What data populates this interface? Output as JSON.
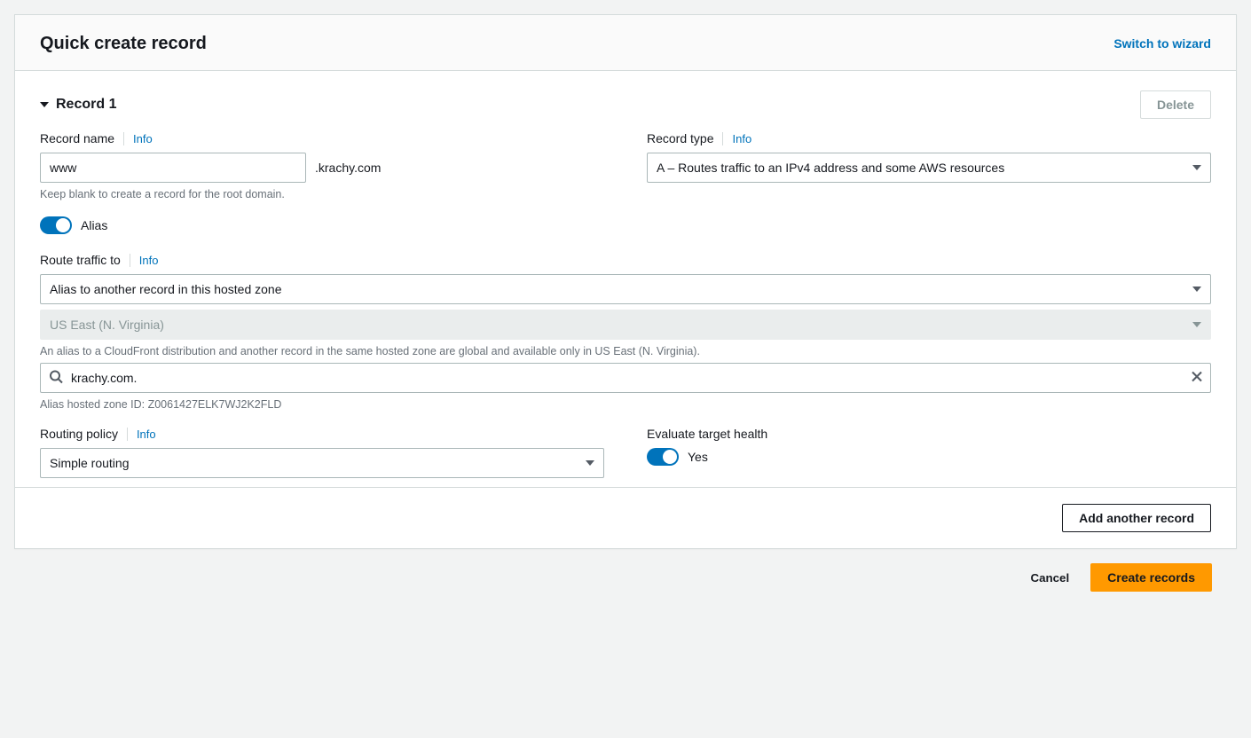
{
  "header": {
    "title": "Quick create record",
    "switch_link": "Switch to wizard"
  },
  "record": {
    "title": "Record 1",
    "delete_label": "Delete",
    "name_label": "Record name",
    "name_info": "Info",
    "name_value": "www",
    "name_suffix": ".krachy.com",
    "name_hint": "Keep blank to create a record for the root domain.",
    "type_label": "Record type",
    "type_info": "Info",
    "type_value": "A – Routes traffic to an IPv4 address and some AWS resources",
    "alias_label": "Alias",
    "route_label": "Route traffic to",
    "route_info": "Info",
    "route_value": "Alias to another record in this hosted zone",
    "region_value": "US East (N. Virginia)",
    "region_hint": "An alias to a CloudFront distribution and another record in the same hosted zone are global and available only in US East (N. Virginia).",
    "target_value": "krachy.com.",
    "target_hint": "Alias hosted zone ID: Z0061427ELK7WJ2K2FLD",
    "policy_label": "Routing policy",
    "policy_info": "Info",
    "policy_value": "Simple routing",
    "eval_label": "Evaluate target health",
    "eval_value": "Yes"
  },
  "footer": {
    "add_label": "Add another record",
    "cancel_label": "Cancel",
    "create_label": "Create records"
  }
}
